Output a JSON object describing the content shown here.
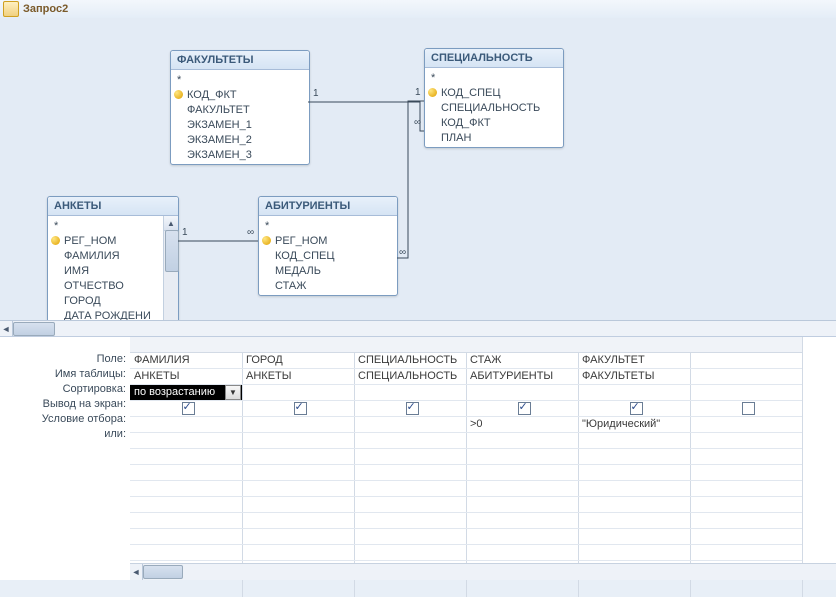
{
  "window": {
    "title": "Запрос2"
  },
  "tables": {
    "faculties": {
      "title": "ФАКУЛЬТЕТЫ",
      "star": "*",
      "fields": [
        "КОД_ФКТ",
        "ФАКУЛЬТЕТ",
        "ЭКЗАМЕН_1",
        "ЭКЗАМЕН_2",
        "ЭКЗАМЕН_3"
      ]
    },
    "speciality": {
      "title": "СПЕЦИАЛЬНОСТЬ",
      "star": "*",
      "fields": [
        "КОД_СПЕЦ",
        "СПЕЦИАЛЬНОСТЬ",
        "КОД_ФКТ",
        "ПЛАН"
      ]
    },
    "ankety": {
      "title": "АНКЕТЫ",
      "star": "*",
      "fields": [
        "РЕГ_НОМ",
        "ФАМИЛИЯ",
        "ИМЯ",
        "ОТЧЕСТВО",
        "ГОРОД",
        "ДАТА РОЖДЕНИ"
      ]
    },
    "abiturients": {
      "title": "АБИТУРИЕНТЫ",
      "star": "*",
      "fields": [
        "РЕГ_НОМ",
        "КОД_СПЕЦ",
        "МЕДАЛЬ",
        "СТАЖ"
      ]
    }
  },
  "relations": {
    "one": "1",
    "many": "∞"
  },
  "gridLabels": {
    "field": "Поле:",
    "table": "Имя таблицы:",
    "sort": "Сортировка:",
    "show": "Вывод на экран:",
    "criteria": "Условие отбора:",
    "or": "или:"
  },
  "columns": [
    {
      "field": "ФАМИЛИЯ",
      "table": "АНКЕТЫ",
      "sort": "по возрастанию",
      "show": true,
      "criteria": "",
      "or": ""
    },
    {
      "field": "ГОРОД",
      "table": "АНКЕТЫ",
      "sort": "",
      "show": true,
      "criteria": "",
      "or": ""
    },
    {
      "field": "СПЕЦИАЛЬНОСТЬ",
      "table": "СПЕЦИАЛЬНОСТЬ",
      "sort": "",
      "show": true,
      "criteria": "",
      "or": ""
    },
    {
      "field": "СТАЖ",
      "table": "АБИТУРИЕНТЫ",
      "sort": "",
      "show": true,
      "criteria": ">0",
      "or": ""
    },
    {
      "field": "ФАКУЛЬТЕТ",
      "table": "ФАКУЛЬТЕТЫ",
      "sort": "",
      "show": true,
      "criteria": "\"Юридический\"",
      "or": ""
    },
    {
      "field": "",
      "table": "",
      "sort": "",
      "show": false,
      "criteria": "",
      "or": ""
    }
  ]
}
